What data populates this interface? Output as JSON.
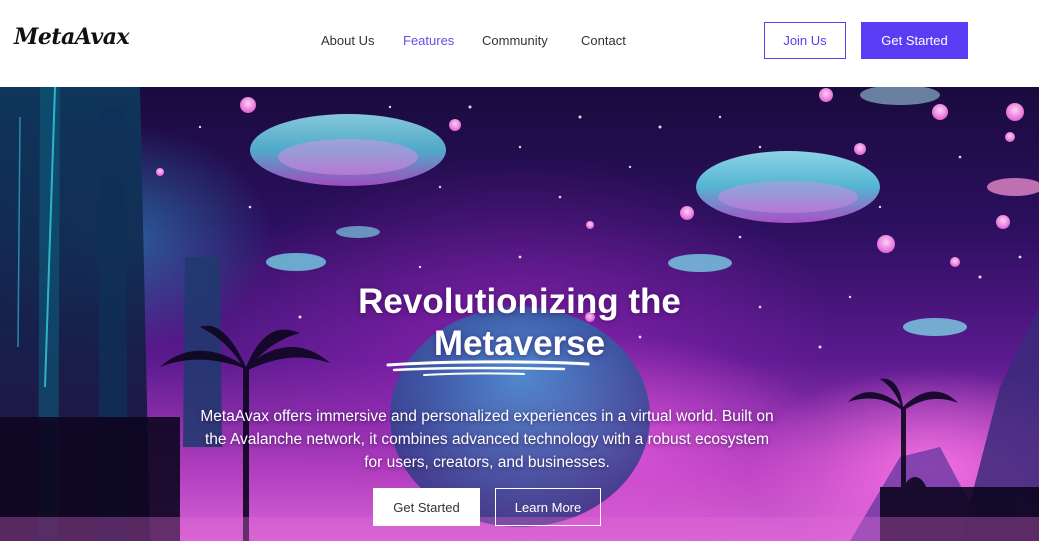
{
  "brand": {
    "logo_text": "MetaAvax"
  },
  "nav": {
    "items": [
      {
        "label": "About Us",
        "active": false
      },
      {
        "label": "Features",
        "active": true
      },
      {
        "label": "Community",
        "active": false
      },
      {
        "label": "Contact",
        "active": false
      }
    ]
  },
  "header_actions": {
    "join_label": "Join Us",
    "get_started_label": "Get Started"
  },
  "hero": {
    "title_line1": "Revolutionizing the",
    "title_line2": "Metaverse",
    "description": "MetaAvax offers immersive and personalized experiences in a virtual world. Built on the Avalanche network, it combines advanced technology with a robust ecosystem for users, creators, and businesses.",
    "primary_button": "Get Started",
    "secondary_button": "Learn More"
  },
  "colors": {
    "accent": "#5b3cf5",
    "active_nav": "#6a4de6",
    "hero_top": "#1a0b3e",
    "hero_bottom": "#d563d2"
  }
}
